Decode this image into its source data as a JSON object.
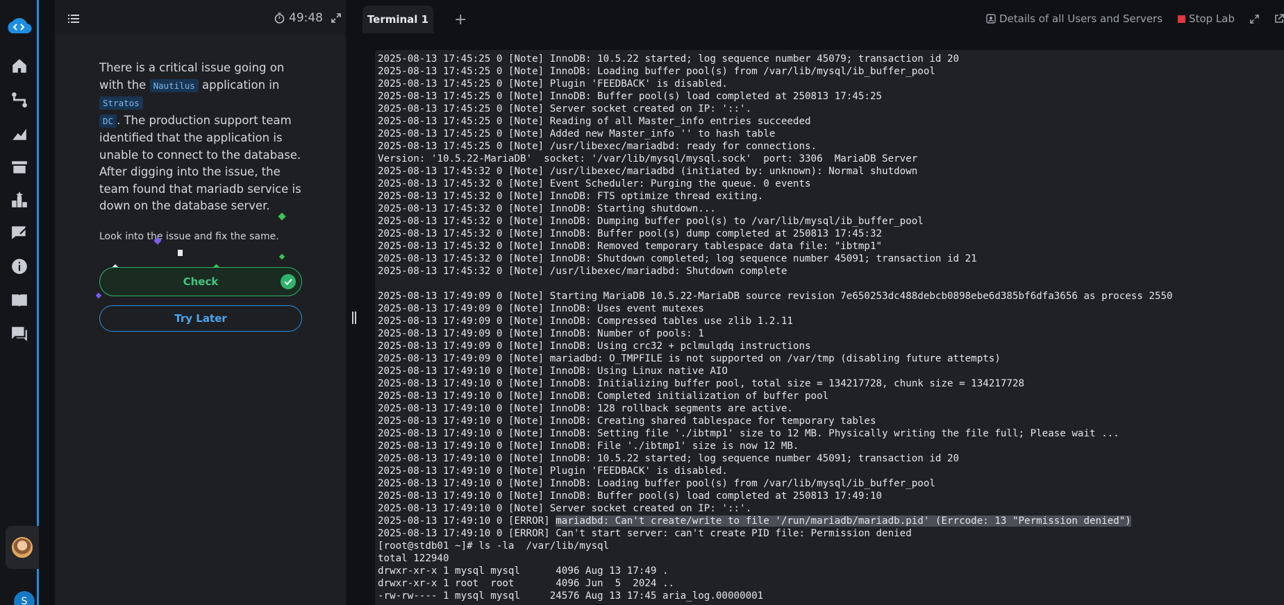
{
  "sidebar": {
    "nav_icons": [
      "home-icon",
      "roadmap-icon",
      "chart-icon",
      "lab-icon",
      "leaderboard-icon",
      "feedback-icon",
      "info-icon",
      "docs-icon",
      "chat-icon"
    ],
    "user_initial": "S"
  },
  "task": {
    "timer": "49:48",
    "paragraph_1_pre": "There is a critical issue going on with the ",
    "app_name": "Nautilus",
    "paragraph_1_mid": " application in ",
    "dc_name_a": "Stratos",
    "dc_name_b": "DC",
    "paragraph_1_post": ". The production support team identified that the application is unable to connect to the database. After digging into the issue, the team found that mariadb service is down on the database server.",
    "instruction": "Look into the issue and fix the same.",
    "check_label": "Check",
    "try_later_label": "Try Later"
  },
  "topbar": {
    "tab_label": "Terminal 1",
    "add_tab": "+",
    "details_label": "Details of all Users and Servers",
    "stop_label": "Stop Lab"
  },
  "terminal": {
    "lines": [
      "2025-08-13 17:45:25 0 [Note] InnoDB: 10.5.22 started; log sequence number 45079; transaction id 20",
      "2025-08-13 17:45:25 0 [Note] InnoDB: Loading buffer pool(s) from /var/lib/mysql/ib_buffer_pool",
      "2025-08-13 17:45:25 0 [Note] Plugin 'FEEDBACK' is disabled.",
      "2025-08-13 17:45:25 0 [Note] InnoDB: Buffer pool(s) load completed at 250813 17:45:25",
      "2025-08-13 17:45:25 0 [Note] Server socket created on IP: '::'.",
      "2025-08-13 17:45:25 0 [Note] Reading of all Master_info entries succeeded",
      "2025-08-13 17:45:25 0 [Note] Added new Master_info '' to hash table",
      "2025-08-13 17:45:25 0 [Note] /usr/libexec/mariadbd: ready for connections.",
      "Version: '10.5.22-MariaDB'  socket: '/var/lib/mysql/mysql.sock'  port: 3306  MariaDB Server",
      "2025-08-13 17:45:32 0 [Note] /usr/libexec/mariadbd (initiated by: unknown): Normal shutdown",
      "2025-08-13 17:45:32 0 [Note] Event Scheduler: Purging the queue. 0 events",
      "2025-08-13 17:45:32 0 [Note] InnoDB: FTS optimize thread exiting.",
      "2025-08-13 17:45:32 0 [Note] InnoDB: Starting shutdown...",
      "2025-08-13 17:45:32 0 [Note] InnoDB: Dumping buffer pool(s) to /var/lib/mysql/ib_buffer_pool",
      "2025-08-13 17:45:32 0 [Note] InnoDB: Buffer pool(s) dump completed at 250813 17:45:32",
      "2025-08-13 17:45:32 0 [Note] InnoDB: Removed temporary tablespace data file: \"ibtmp1\"",
      "2025-08-13 17:45:32 0 [Note] InnoDB: Shutdown completed; log sequence number 45091; transaction id 21",
      "2025-08-13 17:45:32 0 [Note] /usr/libexec/mariadbd: Shutdown complete",
      "",
      "2025-08-13 17:49:09 0 [Note] Starting MariaDB 10.5.22-MariaDB source revision 7e650253dc488debcb0898ebe6d385bf6dfa3656 as process 2550",
      "2025-08-13 17:49:09 0 [Note] InnoDB: Uses event mutexes",
      "2025-08-13 17:49:09 0 [Note] InnoDB: Compressed tables use zlib 1.2.11",
      "2025-08-13 17:49:09 0 [Note] InnoDB: Number of pools: 1",
      "2025-08-13 17:49:09 0 [Note] InnoDB: Using crc32 + pclmulqdq instructions",
      "2025-08-13 17:49:09 0 [Note] mariadbd: O_TMPFILE is not supported on /var/tmp (disabling future attempts)",
      "2025-08-13 17:49:10 0 [Note] InnoDB: Using Linux native AIO",
      "2025-08-13 17:49:10 0 [Note] InnoDB: Initializing buffer pool, total size = 134217728, chunk size = 134217728",
      "2025-08-13 17:49:10 0 [Note] InnoDB: Completed initialization of buffer pool",
      "2025-08-13 17:49:10 0 [Note] InnoDB: 128 rollback segments are active.",
      "2025-08-13 17:49:10 0 [Note] InnoDB: Creating shared tablespace for temporary tables",
      "2025-08-13 17:49:10 0 [Note] InnoDB: Setting file './ibtmp1' size to 12 MB. Physically writing the file full; Please wait ...",
      "2025-08-13 17:49:10 0 [Note] InnoDB: File './ibtmp1' size is now 12 MB.",
      "2025-08-13 17:49:10 0 [Note] InnoDB: 10.5.22 started; log sequence number 45091; transaction id 20",
      "2025-08-13 17:49:10 0 [Note] Plugin 'FEEDBACK' is disabled.",
      "2025-08-13 17:49:10 0 [Note] InnoDB: Loading buffer pool(s) from /var/lib/mysql/ib_buffer_pool",
      "2025-08-13 17:49:10 0 [Note] InnoDB: Buffer pool(s) load completed at 250813 17:49:10",
      "2025-08-13 17:49:10 0 [Note] Server socket created on IP: '::'."
    ],
    "error_prefix": "2025-08-13 17:49:10 0 [ERROR] ",
    "error_highlight": "mariadbd: Can't create/write to file '/run/mariadb/mariadb.pid' (Errcode: 13 \"Permission denied\")",
    "lines_after": [
      "2025-08-13 17:49:10 0 [ERROR] Can't start server: can't create PID file: Permission denied",
      "[root@stdb01 ~]# ls -la  /var/lib/mysql",
      "total 122940",
      "drwxr-xr-x 1 mysql mysql      4096 Aug 13 17:49 .",
      "drwxr-xr-x 1 root  root       4096 Jun  5  2024 ..",
      "-rw-rw---- 1 mysql mysql     24576 Aug 13 17:45 aria_log.00000001"
    ]
  }
}
